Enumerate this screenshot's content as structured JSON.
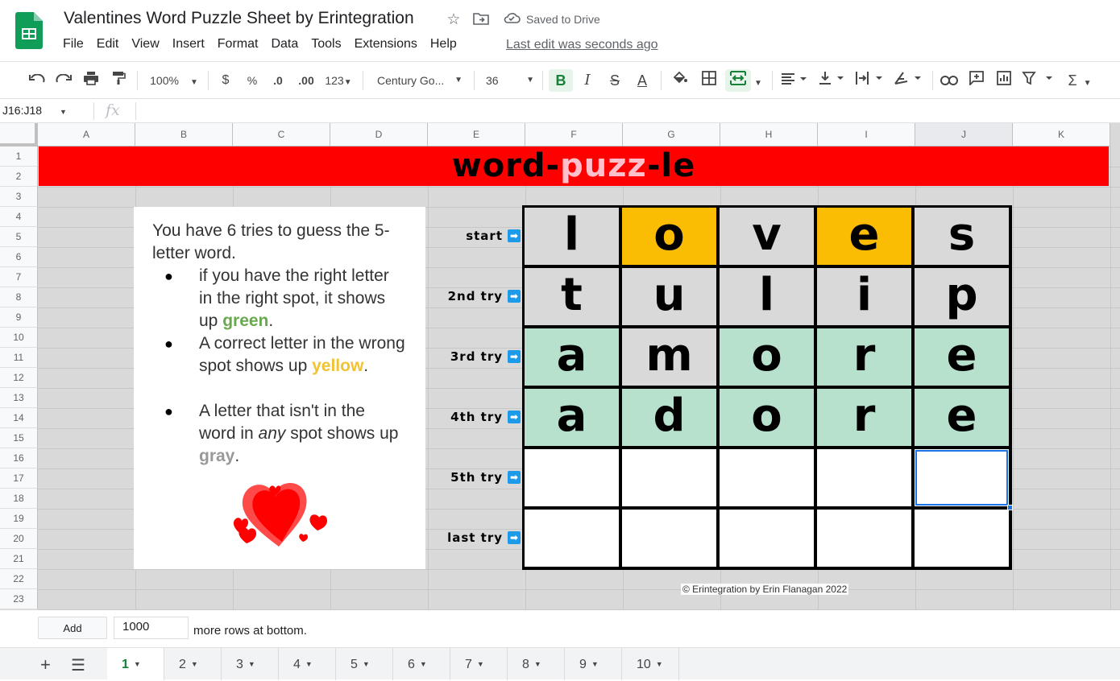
{
  "app": {
    "doc_title": "Valentines Word Puzzle Sheet by Erintegration",
    "saved_status": "Saved to Drive",
    "last_edit": "Last edit was seconds ago",
    "icons": [
      "sheets-logo-icon",
      "star-icon",
      "move-folder-icon",
      "cloud-saved-icon"
    ]
  },
  "menu": [
    "File",
    "Edit",
    "View",
    "Insert",
    "Format",
    "Data",
    "Tools",
    "Extensions",
    "Help"
  ],
  "toolbar": {
    "zoom": "100%",
    "currency": "$",
    "percent": "%",
    "decrease_decimal": ".0",
    "increase_decimal": ".00",
    "more_formats": "123",
    "font_family": "Century Go...",
    "font_size": "36",
    "bold": "B",
    "italic": "I",
    "strikethrough": "S",
    "text_color": "A",
    "function_symbol": "Σ"
  },
  "formula_bar": {
    "name_box": "J16:J18",
    "fx_label": "fx",
    "value": ""
  },
  "grid": {
    "columns": [
      "A",
      "B",
      "C",
      "D",
      "E",
      "F",
      "G",
      "H",
      "I",
      "J",
      "K"
    ],
    "selected_column": "J",
    "rows": [
      "1",
      "2",
      "3",
      "4",
      "5",
      "6",
      "7",
      "8",
      "9",
      "10",
      "11",
      "12",
      "13",
      "14",
      "15",
      "16",
      "17",
      "18",
      "19",
      "20",
      "21",
      "22",
      "23"
    ]
  },
  "banner": {
    "part1": "word-",
    "part2": "puzz",
    "part3": "-le",
    "bg_color": "#ff0000",
    "accent_color": "#ffc0cb"
  },
  "instructions": {
    "intro": "You have 6 tries to guess the 5-letter word.",
    "rules": [
      {
        "pre": "if you have the right letter in the right spot, it shows up ",
        "color_word": "green",
        "post": "."
      },
      {
        "pre": "A correct letter in the wrong spot shows up ",
        "color_word": "yellow",
        "post": "."
      },
      {
        "pre": "A letter that isn't in the word in ",
        "emph": "any",
        "mid": " spot shows up ",
        "color_word": "gray",
        "post": "."
      }
    ],
    "bullet": "●"
  },
  "tries": [
    {
      "label": "start",
      "arrow": "➡"
    },
    {
      "label": "2nd try",
      "arrow": "➡"
    },
    {
      "label": "3rd try",
      "arrow": "➡"
    },
    {
      "label": "4th try",
      "arrow": "➡"
    },
    {
      "label": "5th try",
      "arrow": "➡"
    },
    {
      "label": "last try",
      "arrow": "➡"
    }
  ],
  "board": {
    "colors": {
      "gray": "#d9d9d9",
      "yellow": "#fbbc04",
      "green": "#b7e1cd",
      "empty": "#ffffff"
    },
    "rows": [
      [
        {
          "l": "l",
          "s": "gray"
        },
        {
          "l": "o",
          "s": "yellow"
        },
        {
          "l": "v",
          "s": "gray"
        },
        {
          "l": "e",
          "s": "yellow"
        },
        {
          "l": "s",
          "s": "gray"
        }
      ],
      [
        {
          "l": "t",
          "s": "gray"
        },
        {
          "l": "u",
          "s": "gray"
        },
        {
          "l": "l",
          "s": "gray"
        },
        {
          "l": "i",
          "s": "gray"
        },
        {
          "l": "p",
          "s": "gray"
        }
      ],
      [
        {
          "l": "a",
          "s": "green"
        },
        {
          "l": "m",
          "s": "gray"
        },
        {
          "l": "o",
          "s": "green"
        },
        {
          "l": "r",
          "s": "green"
        },
        {
          "l": "e",
          "s": "green"
        }
      ],
      [
        {
          "l": "a",
          "s": "green"
        },
        {
          "l": "d",
          "s": "green"
        },
        {
          "l": "o",
          "s": "green"
        },
        {
          "l": "r",
          "s": "green"
        },
        {
          "l": "e",
          "s": "green"
        }
      ],
      [
        {
          "l": "",
          "s": "empty"
        },
        {
          "l": "",
          "s": "empty"
        },
        {
          "l": "",
          "s": "empty"
        },
        {
          "l": "",
          "s": "empty"
        },
        {
          "l": "",
          "s": "empty",
          "selected": true
        }
      ],
      [
        {
          "l": "",
          "s": "empty"
        },
        {
          "l": "",
          "s": "empty"
        },
        {
          "l": "",
          "s": "empty"
        },
        {
          "l": "",
          "s": "empty"
        },
        {
          "l": "",
          "s": "empty"
        }
      ]
    ]
  },
  "copyright": "© Erintegration by Erin Flanagan 2022",
  "add_rows": {
    "button": "Add",
    "count": "1000",
    "suffix": "more rows at bottom."
  },
  "sheets": {
    "active": "1",
    "tabs": [
      "1",
      "2",
      "3",
      "4",
      "5",
      "6",
      "7",
      "8",
      "9",
      "10"
    ]
  }
}
